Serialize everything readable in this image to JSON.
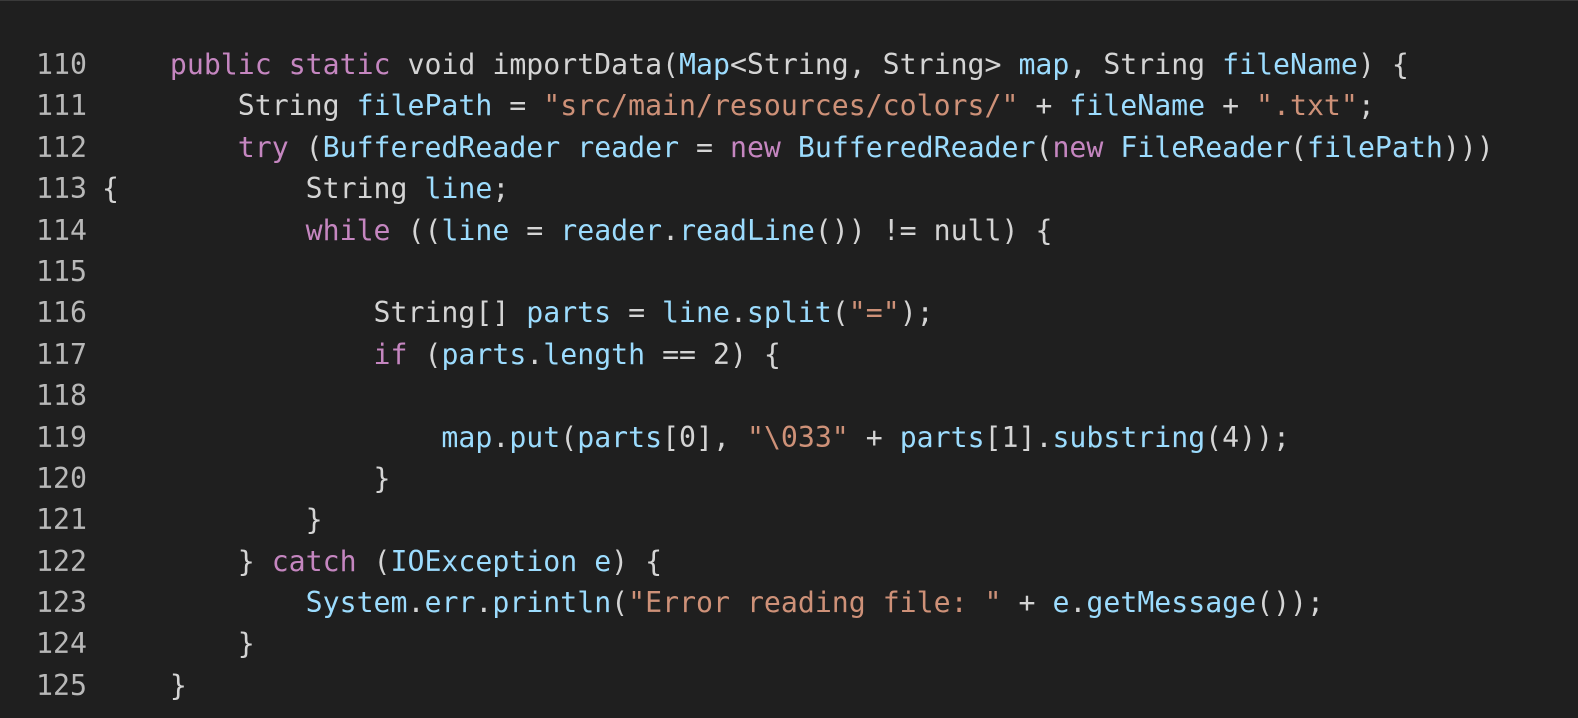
{
  "colors": {
    "background": "#1f1f1f",
    "keyword": "#c586c0",
    "identifier": "#9cdcfe",
    "string": "#ce9178",
    "number": "#b5cea8",
    "plain": "#d4d4d4",
    "line_number": "#b8b8b8"
  },
  "lines": [
    {
      "number": "110",
      "tokens": [
        {
          "t": "    ",
          "c": "pl"
        },
        {
          "t": "public",
          "c": "kw"
        },
        {
          "t": " ",
          "c": "pl"
        },
        {
          "t": "static",
          "c": "kw"
        },
        {
          "t": " void importData(",
          "c": "pl"
        },
        {
          "t": "Map",
          "c": "id"
        },
        {
          "t": "<String, String> ",
          "c": "pl"
        },
        {
          "t": "map",
          "c": "id"
        },
        {
          "t": ", String ",
          "c": "pl"
        },
        {
          "t": "fileName",
          "c": "id"
        },
        {
          "t": ") {",
          "c": "pl"
        }
      ]
    },
    {
      "number": "111",
      "tokens": [
        {
          "t": "        String ",
          "c": "pl"
        },
        {
          "t": "filePath",
          "c": "id"
        },
        {
          "t": " = ",
          "c": "pl"
        },
        {
          "t": "\"src/main/resources/colors/\"",
          "c": "st"
        },
        {
          "t": " + ",
          "c": "pl"
        },
        {
          "t": "fileName",
          "c": "id"
        },
        {
          "t": " + ",
          "c": "pl"
        },
        {
          "t": "\".txt\"",
          "c": "st"
        },
        {
          "t": ";",
          "c": "pl"
        }
      ]
    },
    {
      "number": "112",
      "tokens": [
        {
          "t": "        ",
          "c": "pl"
        },
        {
          "t": "try",
          "c": "kw"
        },
        {
          "t": " (",
          "c": "pl"
        },
        {
          "t": "BufferedReader",
          "c": "id"
        },
        {
          "t": " ",
          "c": "pl"
        },
        {
          "t": "reader",
          "c": "id"
        },
        {
          "t": " = ",
          "c": "pl"
        },
        {
          "t": "new",
          "c": "kw"
        },
        {
          "t": " ",
          "c": "pl"
        },
        {
          "t": "BufferedReader",
          "c": "id"
        },
        {
          "t": "(",
          "c": "pl"
        },
        {
          "t": "new",
          "c": "kw"
        },
        {
          "t": " ",
          "c": "pl"
        },
        {
          "t": "FileReader",
          "c": "id"
        },
        {
          "t": "(",
          "c": "pl"
        },
        {
          "t": "filePath",
          "c": "id"
        },
        {
          "t": ")))",
          "c": "pl"
        }
      ]
    },
    {
      "number": "113",
      "tokens": [
        {
          "t": "{           String ",
          "c": "pl"
        },
        {
          "t": "line",
          "c": "id"
        },
        {
          "t": ";",
          "c": "pl"
        }
      ]
    },
    {
      "number": "114",
      "tokens": [
        {
          "t": "            ",
          "c": "pl"
        },
        {
          "t": "while",
          "c": "kw"
        },
        {
          "t": " ((",
          "c": "pl"
        },
        {
          "t": "line",
          "c": "id"
        },
        {
          "t": " = ",
          "c": "pl"
        },
        {
          "t": "reader",
          "c": "id"
        },
        {
          "t": ".",
          "c": "pl"
        },
        {
          "t": "readLine",
          "c": "id"
        },
        {
          "t": "()) != null) {",
          "c": "pl"
        }
      ]
    },
    {
      "number": "115",
      "tokens": []
    },
    {
      "number": "116",
      "tokens": [
        {
          "t": "                String[] ",
          "c": "pl"
        },
        {
          "t": "parts",
          "c": "id"
        },
        {
          "t": " = ",
          "c": "pl"
        },
        {
          "t": "line",
          "c": "id"
        },
        {
          "t": ".",
          "c": "pl"
        },
        {
          "t": "split",
          "c": "id"
        },
        {
          "t": "(",
          "c": "pl"
        },
        {
          "t": "\"=\"",
          "c": "st"
        },
        {
          "t": ");",
          "c": "pl"
        }
      ]
    },
    {
      "number": "117",
      "tokens": [
        {
          "t": "                ",
          "c": "pl"
        },
        {
          "t": "if",
          "c": "kw"
        },
        {
          "t": " (",
          "c": "pl"
        },
        {
          "t": "parts",
          "c": "id"
        },
        {
          "t": ".",
          "c": "pl"
        },
        {
          "t": "length",
          "c": "id"
        },
        {
          "t": " == 2) {",
          "c": "pl"
        }
      ]
    },
    {
      "number": "118",
      "tokens": []
    },
    {
      "number": "119",
      "tokens": [
        {
          "t": "                    ",
          "c": "pl"
        },
        {
          "t": "map",
          "c": "id"
        },
        {
          "t": ".",
          "c": "pl"
        },
        {
          "t": "put",
          "c": "id"
        },
        {
          "t": "(",
          "c": "pl"
        },
        {
          "t": "parts",
          "c": "id"
        },
        {
          "t": "[0], ",
          "c": "pl"
        },
        {
          "t": "\"\\033\"",
          "c": "st"
        },
        {
          "t": " + ",
          "c": "pl"
        },
        {
          "t": "parts",
          "c": "id"
        },
        {
          "t": "[1].",
          "c": "pl"
        },
        {
          "t": "substring",
          "c": "id"
        },
        {
          "t": "(4));",
          "c": "pl"
        }
      ]
    },
    {
      "number": "120",
      "tokens": [
        {
          "t": "                }",
          "c": "pl"
        }
      ]
    },
    {
      "number": "121",
      "tokens": [
        {
          "t": "            }",
          "c": "pl"
        }
      ]
    },
    {
      "number": "122",
      "tokens": [
        {
          "t": "        } ",
          "c": "pl"
        },
        {
          "t": "catch",
          "c": "kw"
        },
        {
          "t": " (",
          "c": "pl"
        },
        {
          "t": "IOException",
          "c": "id"
        },
        {
          "t": " ",
          "c": "pl"
        },
        {
          "t": "e",
          "c": "id"
        },
        {
          "t": ") {",
          "c": "pl"
        }
      ]
    },
    {
      "number": "123",
      "tokens": [
        {
          "t": "            ",
          "c": "pl"
        },
        {
          "t": "System",
          "c": "id"
        },
        {
          "t": ".",
          "c": "pl"
        },
        {
          "t": "err",
          "c": "id"
        },
        {
          "t": ".",
          "c": "pl"
        },
        {
          "t": "println",
          "c": "id"
        },
        {
          "t": "(",
          "c": "pl"
        },
        {
          "t": "\"Error reading file: \"",
          "c": "st"
        },
        {
          "t": " + ",
          "c": "pl"
        },
        {
          "t": "e",
          "c": "id"
        },
        {
          "t": ".",
          "c": "pl"
        },
        {
          "t": "getMessage",
          "c": "id"
        },
        {
          "t": "());",
          "c": "pl"
        }
      ]
    },
    {
      "number": "124",
      "tokens": [
        {
          "t": "        }",
          "c": "pl"
        }
      ]
    },
    {
      "number": "125",
      "tokens": [
        {
          "t": "    }",
          "c": "pl"
        }
      ]
    }
  ]
}
